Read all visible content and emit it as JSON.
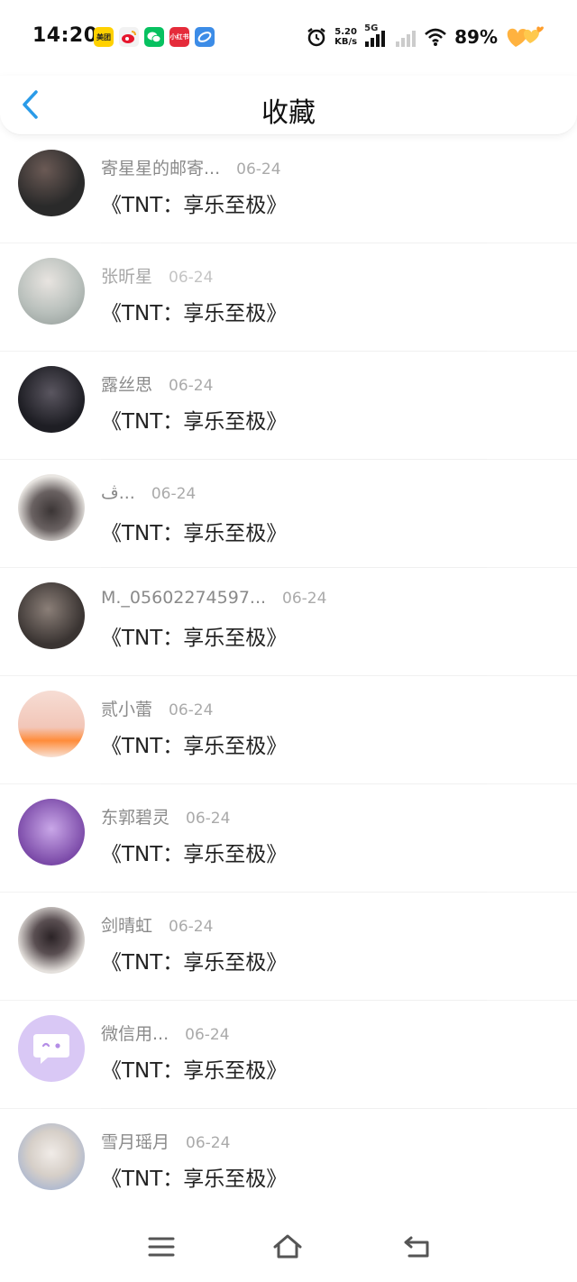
{
  "status_bar": {
    "time": "14:20",
    "app_icons": [
      {
        "name": "meituan-icon",
        "label": "美团",
        "color": "#FFD100",
        "text_color": "#222"
      },
      {
        "name": "weibo-icon",
        "label": "",
        "color": "#F2F2F2",
        "text_color": "#E6162D"
      },
      {
        "name": "wechat-icon",
        "label": "",
        "color": "#07C160",
        "text_color": "#fff"
      },
      {
        "name": "xiaohongshu-icon",
        "label": "小红书",
        "color": "#E52B3A",
        "text_color": "#fff"
      },
      {
        "name": "browser-icon",
        "label": "",
        "color": "#3C8CE7",
        "text_color": "#fff"
      }
    ],
    "net_speed_value": "5.20",
    "net_speed_unit": "KB/s",
    "network_type": "5G",
    "battery": "89%"
  },
  "header": {
    "title": "收藏"
  },
  "items": [
    {
      "username": "寄星星的邮寄...",
      "date": "06-24",
      "title": "《TNT：享乐至极》",
      "light": false
    },
    {
      "username": "张昕星",
      "date": "06-24",
      "title": "《TNT：享乐至极》",
      "light": true
    },
    {
      "username": "露丝思",
      "date": "06-24",
      "title": "《TNT：享乐至极》",
      "light": false
    },
    {
      "username": "ڤ...",
      "date": "06-24",
      "title": "《TNT：享乐至极》",
      "light": false
    },
    {
      "username": "M._05602274597...",
      "date": "06-24",
      "title": "《TNT：享乐至极》",
      "light": false
    },
    {
      "username": "贰小蕾",
      "date": "06-24",
      "title": "《TNT：享乐至极》",
      "light": false
    },
    {
      "username": "东郭碧灵",
      "date": "06-24",
      "title": "《TNT：享乐至极》",
      "light": false
    },
    {
      "username": "剑晴虹",
      "date": "06-24",
      "title": "《TNT：享乐至极》",
      "light": false
    },
    {
      "username": "微信用...",
      "date": "06-24",
      "title": "《TNT：享乐至极》",
      "light": false
    },
    {
      "username": "雪月瑶月",
      "date": "06-24",
      "title": "《TNT：享乐至极》",
      "light": false
    }
  ],
  "avatar_colors": [
    [
      "#2a2a2a",
      "#6b5a55"
    ],
    [
      "#d8d4cf",
      "#9aa3a0"
    ],
    [
      "#1e1e24",
      "#5a5660"
    ],
    [
      "#e9e6e2",
      "#3b3535"
    ],
    [
      "#3a3432",
      "#8b7f78"
    ],
    [
      "#f2c6b8",
      "#ff8c3a"
    ],
    [
      "#7b4aa8",
      "#c9a7e8"
    ],
    [
      "#e4e0dc",
      "#2b2326"
    ],
    [
      "#d9c8f5",
      "#d9c8f5"
    ],
    [
      "#f1ece8",
      "#8ea7d6"
    ]
  ]
}
